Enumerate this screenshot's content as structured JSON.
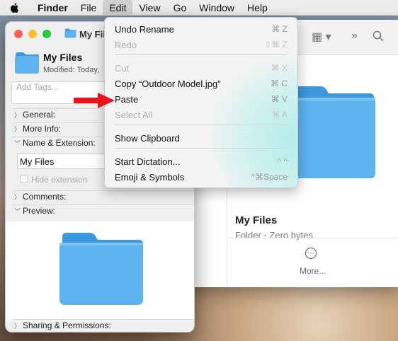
{
  "menubar": {
    "app": "Finder",
    "items": [
      "File",
      "Edit",
      "View",
      "Go",
      "Window",
      "Help"
    ],
    "active": "Edit"
  },
  "info_window": {
    "title": "My Fil",
    "header_name": "My Files",
    "modified": "Modified: Today,",
    "tags_placeholder": "Add Tags...",
    "sections": {
      "general": "General:",
      "more_info": "More Info:",
      "name_ext": "Name & Extension:",
      "comments": "Comments:",
      "preview": "Preview:",
      "sharing": "Sharing & Permissions:"
    },
    "name_value": "My Files",
    "hide_extension": "Hide extension"
  },
  "finder": {
    "preview_name": "My Files",
    "preview_kind": "Folder - Zero bytes",
    "more_label": "More..."
  },
  "edit_menu": {
    "items": [
      {
        "label": "Undo Rename",
        "shortcut": "⌘ Z",
        "enabled": true
      },
      {
        "label": "Redo",
        "shortcut": "⇧⌘ Z",
        "enabled": false
      },
      {
        "label": "Cut",
        "shortcut": "⌘ X",
        "enabled": false
      },
      {
        "label": "Copy “Outdoor Model.jpg”",
        "shortcut": "⌘ C",
        "enabled": true
      },
      {
        "label": "Paste",
        "shortcut": "⌘ V",
        "enabled": true
      },
      {
        "label": "Select All",
        "shortcut": "⌘ A",
        "enabled": false
      },
      {
        "label": "Show Clipboard",
        "shortcut": "",
        "enabled": true
      },
      {
        "label": "Start Dictation...",
        "shortcut": "^ ^",
        "enabled": true
      },
      {
        "label": "Emoji & Symbols",
        "shortcut": "^⌘Space",
        "enabled": true
      }
    ]
  },
  "colors": {
    "folder_blue": "#5eb3ee",
    "folder_tab": "#3d97de",
    "arrow_red": "#e8141a"
  }
}
